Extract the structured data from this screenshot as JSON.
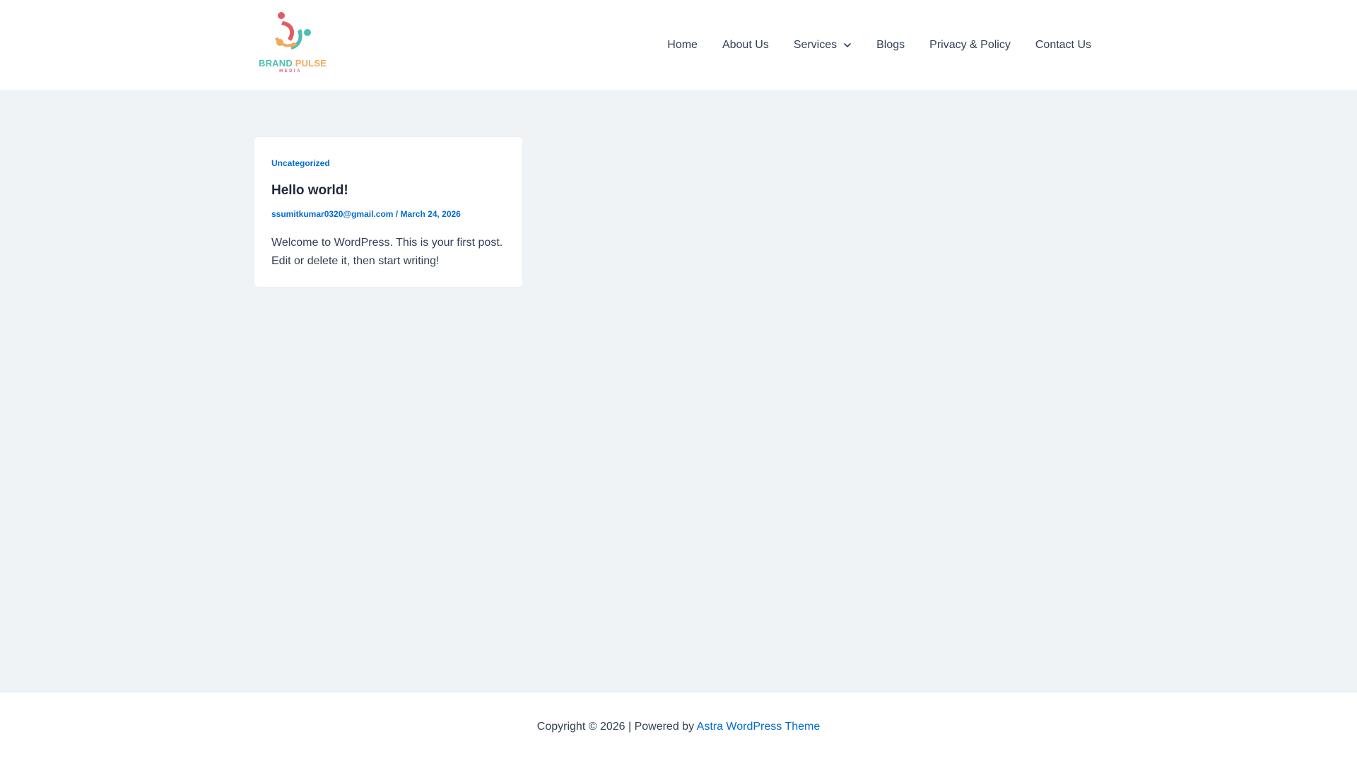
{
  "header": {
    "logo": {
      "word_part1": "BRAND",
      "word_part2": "PULSE",
      "sub": "MEDIA",
      "colors": {
        "red": "#e05c62",
        "teal": "#4bbfb3",
        "orange": "#f3a95d",
        "pink": "#e8627a"
      }
    },
    "nav": [
      {
        "label": "Home"
      },
      {
        "label": "About Us"
      },
      {
        "label": "Services",
        "icon": "chevron-down-icon"
      },
      {
        "label": "Blogs"
      },
      {
        "label": "Privacy & Policy"
      },
      {
        "label": "Contact Us"
      }
    ]
  },
  "post": {
    "category": "Uncategorized",
    "title": "Hello world!",
    "author": "ssumitkumar0320@gmail.com",
    "separator": " / ",
    "date": "March 24, 2026",
    "excerpt": "Welcome to WordPress. This is your first post. Edit or delete it, then start writing!"
  },
  "footer": {
    "text": "Copyright © 2026 | Powered by ",
    "link": "Astra WordPress Theme"
  },
  "colors": {
    "accent": "#046bd2",
    "page_bg": "#eff3f6",
    "text": "#334155",
    "heading": "#1e293b"
  }
}
